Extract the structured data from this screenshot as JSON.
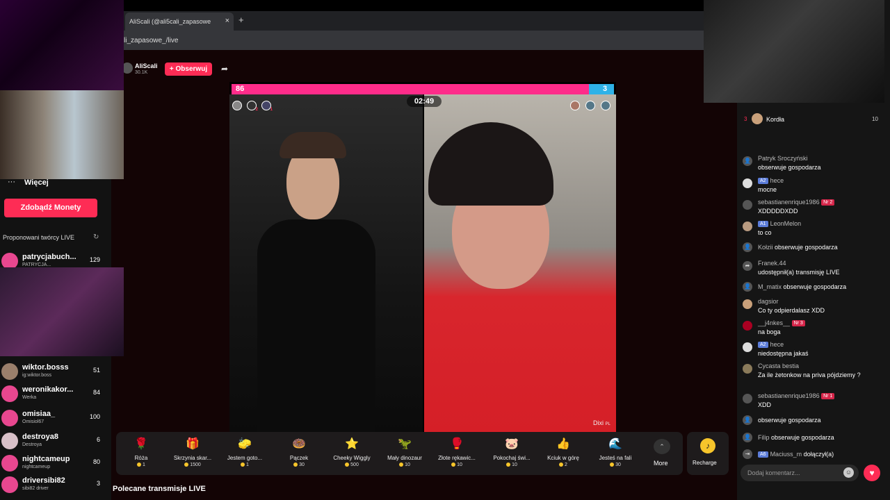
{
  "browser": {
    "tab_title": "AliScali (@ali5cali_zapasowe",
    "tab_close": "×",
    "new_tab": "+",
    "url": "li_zapasowe_/live"
  },
  "host": {
    "name": "AliScali",
    "followers": "30.1K",
    "follow_label": "+ Obserwuj"
  },
  "battle": {
    "score_left": "86",
    "score_right": "3",
    "timer": "02:49",
    "left_badges": [
      "",
      "2",
      "1"
    ],
    "right_watermark": "Dixi",
    "right_watermark_suffix": "PL"
  },
  "gifts": [
    {
      "name": "Róża",
      "price": "1",
      "icon": "🌹"
    },
    {
      "name": "Skrzynia skar...",
      "price": "1500",
      "icon": "🎁"
    },
    {
      "name": "Jestem goto...",
      "price": "1",
      "icon": "🧽"
    },
    {
      "name": "Pączek",
      "price": "30",
      "icon": "🍩"
    },
    {
      "name": "Cheeky Wiggly",
      "price": "500",
      "icon": "⭐"
    },
    {
      "name": "Mały dinozaur",
      "price": "10",
      "icon": "🦖"
    },
    {
      "name": "Złote rękawic...",
      "price": "10",
      "icon": "🥊"
    },
    {
      "name": "Pokochaj świ...",
      "price": "10",
      "icon": "🐷"
    },
    {
      "name": "Kciuk w górę",
      "price": "2",
      "icon": "👍"
    },
    {
      "name": "Jesteś na fali",
      "price": "30",
      "icon": "🌊"
    }
  ],
  "more_label": "More",
  "recharge_label": "Recharge",
  "recommended_title": "Polecane transmisje LIVE",
  "sidebar": {
    "more_label": "Więcej",
    "coins_label": "Zdobądź Monety",
    "proposed_title": "Proponowani twórcy LIVE",
    "creators": [
      {
        "name": "patrycjabuch...",
        "sub": "PATRYCJA...",
        "viewers": "129"
      },
      {
        "name": "wiktor.bosss",
        "sub": "ig:wiktor.boss",
        "viewers": "51"
      },
      {
        "name": "weronikakor...",
        "sub": "Werka",
        "viewers": "84"
      },
      {
        "name": "omisiaa_",
        "sub": "Omisiol67",
        "viewers": "100"
      },
      {
        "name": "destroya8",
        "sub": "Destroya",
        "viewers": "6"
      },
      {
        "name": "nightcameup",
        "sub": "nightcameup",
        "viewers": "80"
      },
      {
        "name": "driversibi82",
        "sub": "sibi82 driver",
        "viewers": "3"
      }
    ]
  },
  "chat": {
    "rank_num": "3",
    "rank_name": "Kordła",
    "rank_value": "10",
    "messages": [
      {
        "user": "Patryk Sroczyński",
        "text": "obserwuje gospodarza",
        "badge": "",
        "layout": "stack"
      },
      {
        "user": "hece",
        "text": "mocne",
        "badge": "A2",
        "layout": "stack"
      },
      {
        "user": "sebastianenrique1986",
        "text": "XDDDDDXDD",
        "badge": "Nr 2",
        "layout": "stack"
      },
      {
        "user": "LeonMelon",
        "text": "to co",
        "badge": "A1",
        "layout": "stack"
      },
      {
        "user": "Kołzii",
        "text": "obserwuje gospodarza",
        "badge": "",
        "layout": "inline"
      },
      {
        "user": "Franek.44",
        "text": "udostępnił(a) transmisję LIVE",
        "badge": "",
        "layout": "stack"
      },
      {
        "user": "M_matix",
        "text": "obserwuje gospodarza",
        "badge": "",
        "layout": "inline"
      },
      {
        "user": "dagsior",
        "text": "Co ty odpierdalasz XDD",
        "badge": "",
        "layout": "stack"
      },
      {
        "user": "__j4nkes__",
        "text": "na boga",
        "badge": "Nr 3",
        "layout": "stack"
      },
      {
        "user": "hece",
        "text": "niedostępna jakaś",
        "badge": "A2",
        "layout": "stack"
      },
      {
        "user": "Cycasta bestia",
        "text": "Za ile żetonkow na priva pójdziemy ?",
        "badge": "",
        "layout": "stack"
      },
      {
        "user": "sebastianenrique1986",
        "text": "XDD",
        "badge": "Nr 1",
        "layout": "stack"
      },
      {
        "user": "",
        "text": "obserwuje gospodarza",
        "badge": "",
        "layout": "inline"
      },
      {
        "user": "Filip",
        "text": "obserwuje gospodarza",
        "badge": "",
        "layout": "inline"
      },
      {
        "user": "Maciuss_m",
        "text": "dołączył(a)",
        "badge": "A6",
        "layout": "inline"
      }
    ],
    "comment_placeholder": "Dodaj komentarz..."
  }
}
